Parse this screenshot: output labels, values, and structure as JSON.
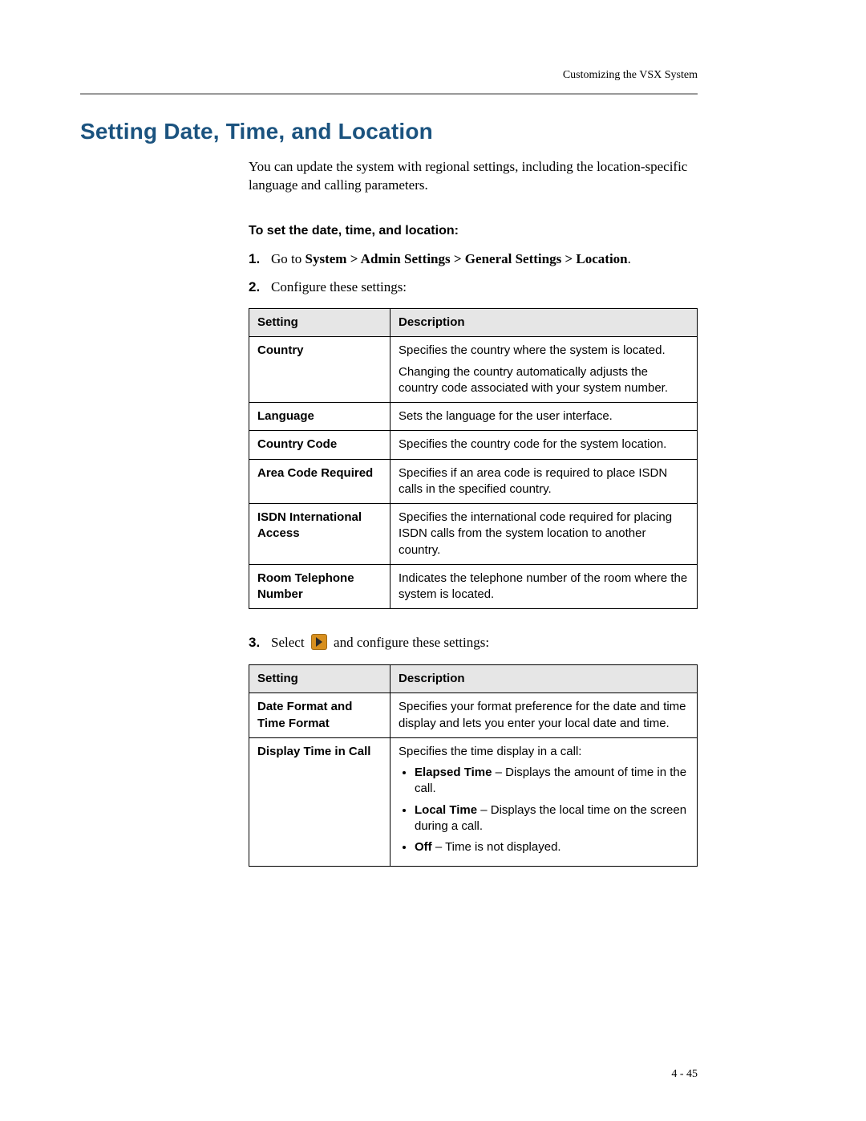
{
  "running_header": "Customizing the VSX System",
  "section_title": "Setting Date, Time, and Location",
  "intro": "You can update the system with regional settings, including the location-specific language and calling parameters.",
  "procedure_title": "To set the date, time, and location:",
  "steps": {
    "s1_prefix": "Go to ",
    "s1_path": "System > Admin Settings > General Settings > Location",
    "s1_suffix": ".",
    "s2_text": "Configure these settings:",
    "s3_prefix": "Select ",
    "s3_suffix": " and configure these settings:"
  },
  "icons": {
    "next": "arrow-right-icon"
  },
  "table_headers": {
    "setting": "Setting",
    "description": "Description"
  },
  "table1": [
    {
      "setting": "Country",
      "desc_p1": "Specifies the country where the system is located.",
      "desc_p2": "Changing the country automatically adjusts the country code associated with your system number."
    },
    {
      "setting": "Language",
      "desc_p1": "Sets the language for the user interface."
    },
    {
      "setting": "Country Code",
      "desc_p1": "Specifies the country code for the system location."
    },
    {
      "setting": "Area Code Required",
      "desc_p1": "Specifies if an area code is required to place ISDN calls in the specified country."
    },
    {
      "setting": "ISDN International Access",
      "desc_p1": "Specifies the international code required for placing ISDN calls from the system location to another country."
    },
    {
      "setting": "Room Telephone Number",
      "desc_p1": "Indicates the telephone number of the room where the system is located."
    }
  ],
  "table2": [
    {
      "setting": "Date Format and Time Format",
      "desc_p1": "Specifies your format preference for the date and time display and lets you enter your local date and time."
    },
    {
      "setting": "Display Time in Call",
      "desc_p1": "Specifies the time display in a call:",
      "bullets": [
        {
          "label": "Elapsed Time",
          "text": " – Displays the amount of time in the call."
        },
        {
          "label": "Local Time",
          "text": " – Displays the local time on the screen during a call."
        },
        {
          "label": "Off",
          "text": " – Time is not displayed."
        }
      ]
    }
  ],
  "page_number": "4 - 45"
}
